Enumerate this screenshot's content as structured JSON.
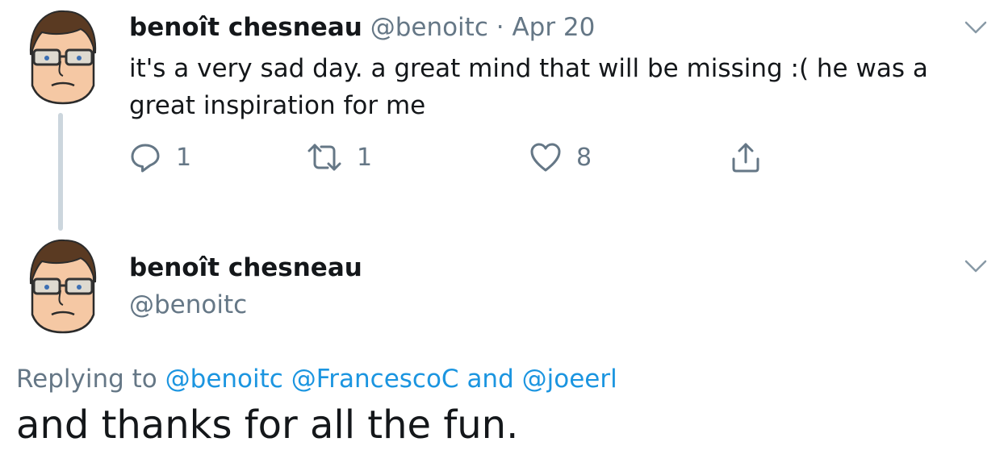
{
  "tweet1": {
    "author_name": "benoît chesneau",
    "handle": "@benoitc",
    "separator": "·",
    "date": "Apr 20",
    "text": "it's a very sad day. a great mind that will be missing :( he was a great inspiration for me",
    "actions": {
      "reply_count": "1",
      "retweet_count": "1",
      "like_count": "8"
    }
  },
  "tweet2": {
    "author_name": "benoît chesneau",
    "handle": "@benoitc",
    "replying_prefix": "Replying to",
    "mentions": [
      "@benoitc",
      "@FrancescoC",
      "@joeerl"
    ],
    "mentions_joiner": "and",
    "text": "and thanks for all the fun."
  },
  "colors": {
    "text": "#14171a",
    "muted": "#657786",
    "link": "#1b95e0",
    "thread_line": "#ccd6dd"
  },
  "icons": [
    "avatar-cartoon-face",
    "chevron-down-icon",
    "reply-icon",
    "retweet-icon",
    "like-icon",
    "share-icon"
  ]
}
